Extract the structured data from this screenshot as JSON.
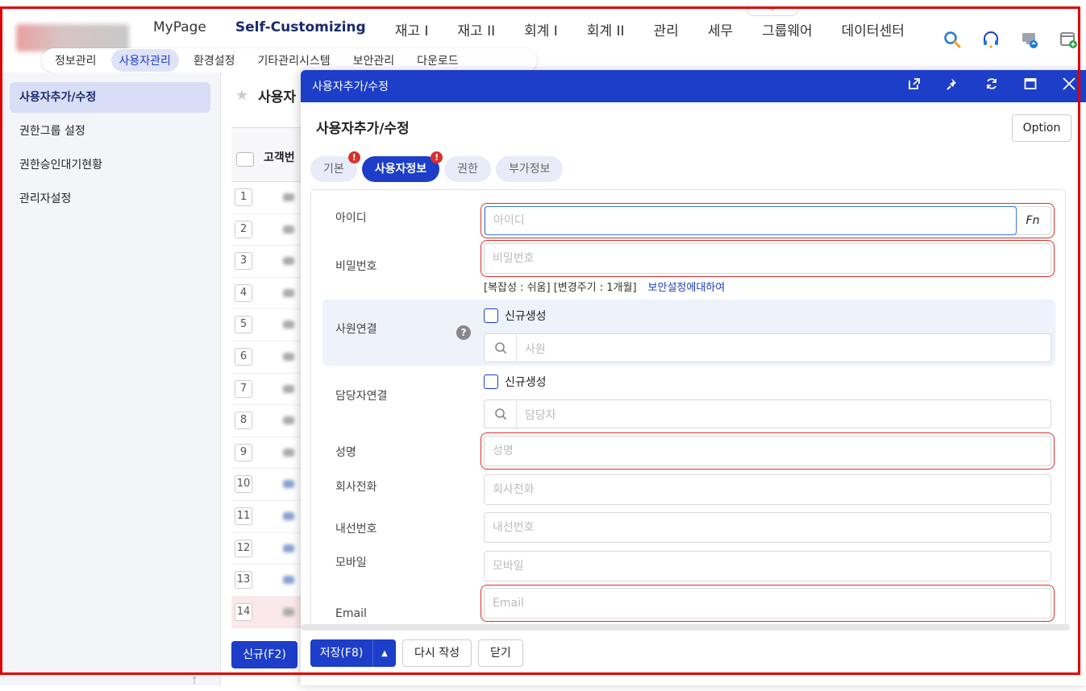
{
  "topnav": {
    "menu": [
      "MyPage",
      "Self-Customizing",
      "재고 I",
      "재고 II",
      "회계 I",
      "회계 II",
      "관리",
      "세무",
      "그룹웨어",
      "데이터센터"
    ],
    "active_menu": "Self-Customizing",
    "submenu": [
      "정보관리",
      "사용자관리",
      "환경설정",
      "기타관리시스템",
      "보안관리",
      "다운로드"
    ],
    "active_submenu": "사용자관리",
    "icons": [
      "search-icon",
      "headset-icon",
      "remote-support-icon",
      "add-window-icon"
    ]
  },
  "sidebar": {
    "items": [
      "사용자추가/수정",
      "권한그룹 설정",
      "권한승인대기현황",
      "관리자설정"
    ]
  },
  "background": {
    "page_title": "사용자",
    "column_header": "고객번",
    "row_numbers": [
      "1",
      "2",
      "3",
      "4",
      "5",
      "6",
      "7",
      "8",
      "9",
      "10",
      "11",
      "12",
      "13",
      "14"
    ],
    "new_button": "신규(F2)"
  },
  "modal": {
    "header_title": "사용자추가/수정",
    "title": "사용자추가/수정",
    "option_button": "Option",
    "tabs": [
      {
        "label": "기본",
        "badge": "!"
      },
      {
        "label": "사용자정보",
        "badge": "!"
      },
      {
        "label": "권한",
        "badge": ""
      },
      {
        "label": "부가정보",
        "badge": ""
      }
    ],
    "fields": {
      "id_label": "아이디",
      "id_placeholder": "아이디",
      "fn_label": "Fn",
      "password_label": "비밀번호",
      "password_placeholder": "비밀번호",
      "password_hint": "[복잡성 : 쉬움] [변경주기 : 1개월]",
      "security_link": "보안설정에대하여",
      "employee_label": "사원연결",
      "employee_new": "신규생성",
      "employee_placeholder": "사원",
      "manager_label": "담당자연결",
      "manager_new": "신규생성",
      "manager_placeholder": "담당자",
      "name_label": "성명",
      "name_placeholder": "성명",
      "company_phone_label": "회사전화",
      "company_phone_placeholder": "회사전화",
      "extension_label": "내선번호",
      "extension_placeholder": "내선번호",
      "mobile_label": "모바일",
      "mobile_placeholder": "모바일",
      "email_label": "Email",
      "email_placeholder": "Email"
    },
    "footer": {
      "save": "저장(F8)",
      "rewrite": "다시 작성",
      "close": "닫기"
    }
  }
}
